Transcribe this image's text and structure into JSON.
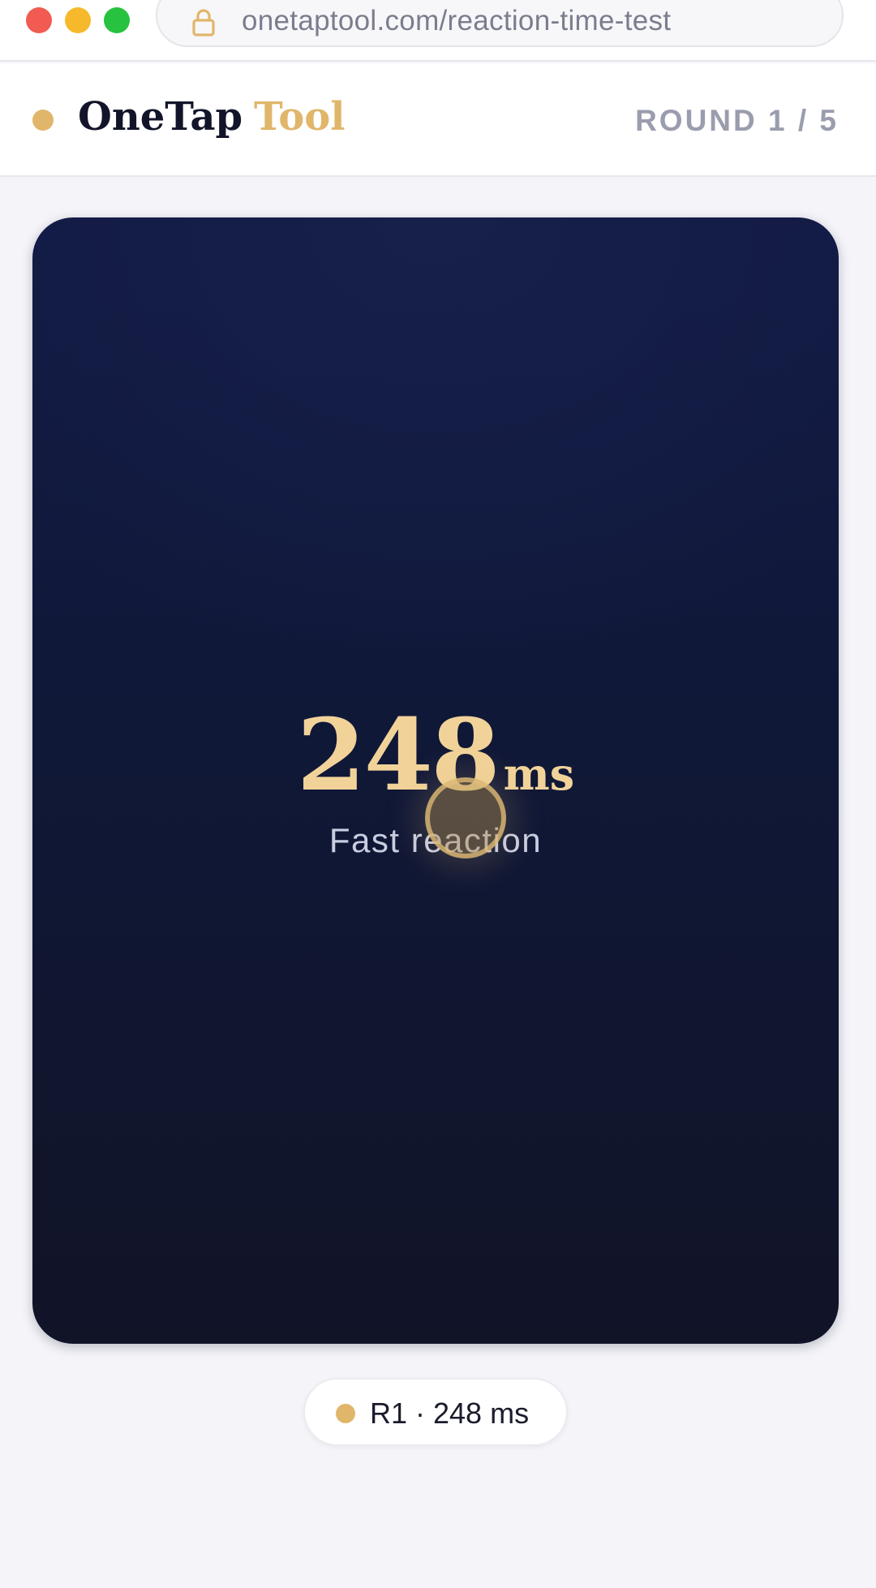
{
  "browser": {
    "url": "onetaptool.com/reaction-time-test",
    "icons": [
      "close-window-icon",
      "minimize-window-icon",
      "maximize-window-icon",
      "lock-icon"
    ]
  },
  "header": {
    "brand_main": "OneTap",
    "brand_accent": "Tool",
    "round": "ROUND 1 / 5"
  },
  "game": {
    "result_value": "248",
    "result_unit": "ms",
    "verdict": "Fast reaction"
  },
  "history": {
    "items": [
      {
        "label": "R1 · 248 ms"
      }
    ]
  },
  "colors": {
    "accent": "#e0b66a",
    "card_background": "#101838",
    "result_text": "#f1d39a",
    "page_background": "#f4f4f9"
  }
}
